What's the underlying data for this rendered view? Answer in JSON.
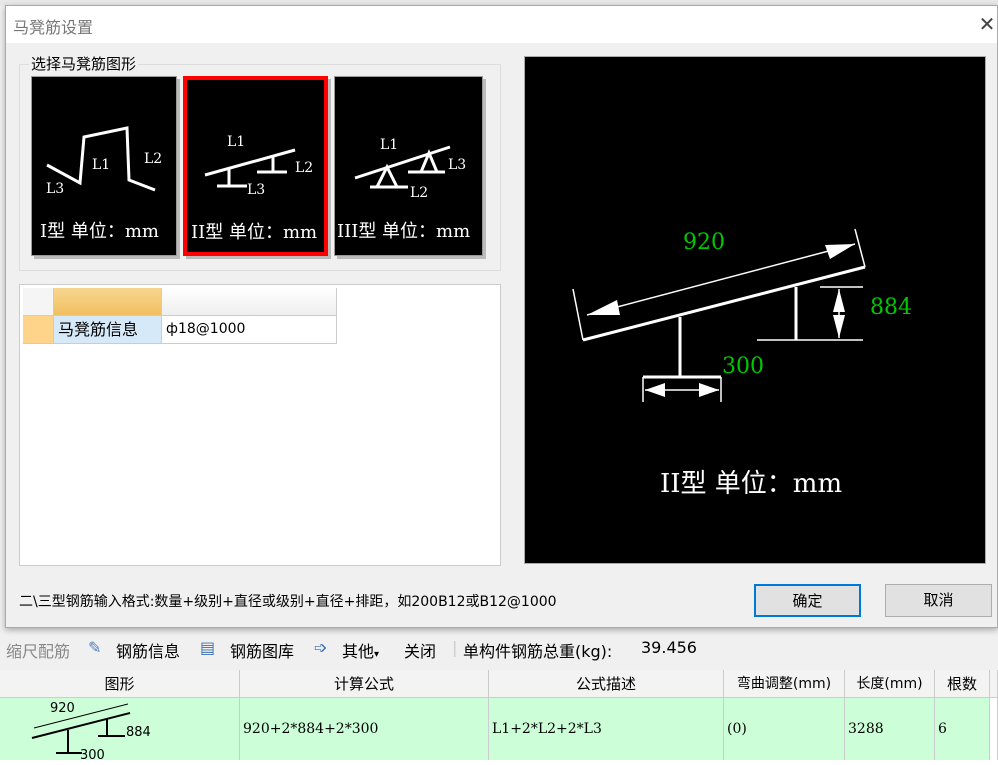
{
  "dialog": {
    "title": "马凳筋设置",
    "close_icon": "close-icon"
  },
  "shape_group": {
    "label": "选择马凳筋图形",
    "selected": "II",
    "options": [
      {
        "id": "I",
        "label": "I型 单位：mm",
        "parts": [
          "L1",
          "L2",
          "L3"
        ]
      },
      {
        "id": "II",
        "label": "II型 单位：mm",
        "parts": [
          "L1",
          "L2",
          "L3"
        ]
      },
      {
        "id": "III",
        "label": "III型 单位：mm",
        "parts": [
          "L1",
          "L2",
          "L3"
        ]
      }
    ]
  },
  "grid": {
    "row_label": "马凳筋信息",
    "row_value": "ф18@1000"
  },
  "preview": {
    "L1": "920",
    "L2": "884",
    "L3": "300",
    "caption": "II型 单位：mm",
    "dim_color": "#00c800"
  },
  "hint": "二\\三型钢筋输入格式:数量+级别+直径或级别+直径+排距，如200B12或B12@1000",
  "buttons": {
    "ok": "确定",
    "cancel": "取消"
  },
  "toolbar": {
    "scale": "缩尺配筋",
    "rebar_info": "钢筋信息",
    "rebar_library": "钢筋图库",
    "other": "其他",
    "close": "关闭",
    "total_weight_label": "单构件钢筋总重(kg):",
    "total_weight": "39.456"
  },
  "table": {
    "headers": [
      "图形",
      "计算公式",
      "公式描述",
      "弯曲调整(mm)",
      "长度(mm)",
      "根数"
    ],
    "rows": [
      {
        "shape": {
          "L1": "920",
          "L2": "884",
          "L3": "300"
        },
        "formula": "920+2*884+2*300",
        "description": "L1+2*L2+2*L3",
        "bend": "(0)",
        "length": "3288",
        "count": "6"
      }
    ]
  }
}
